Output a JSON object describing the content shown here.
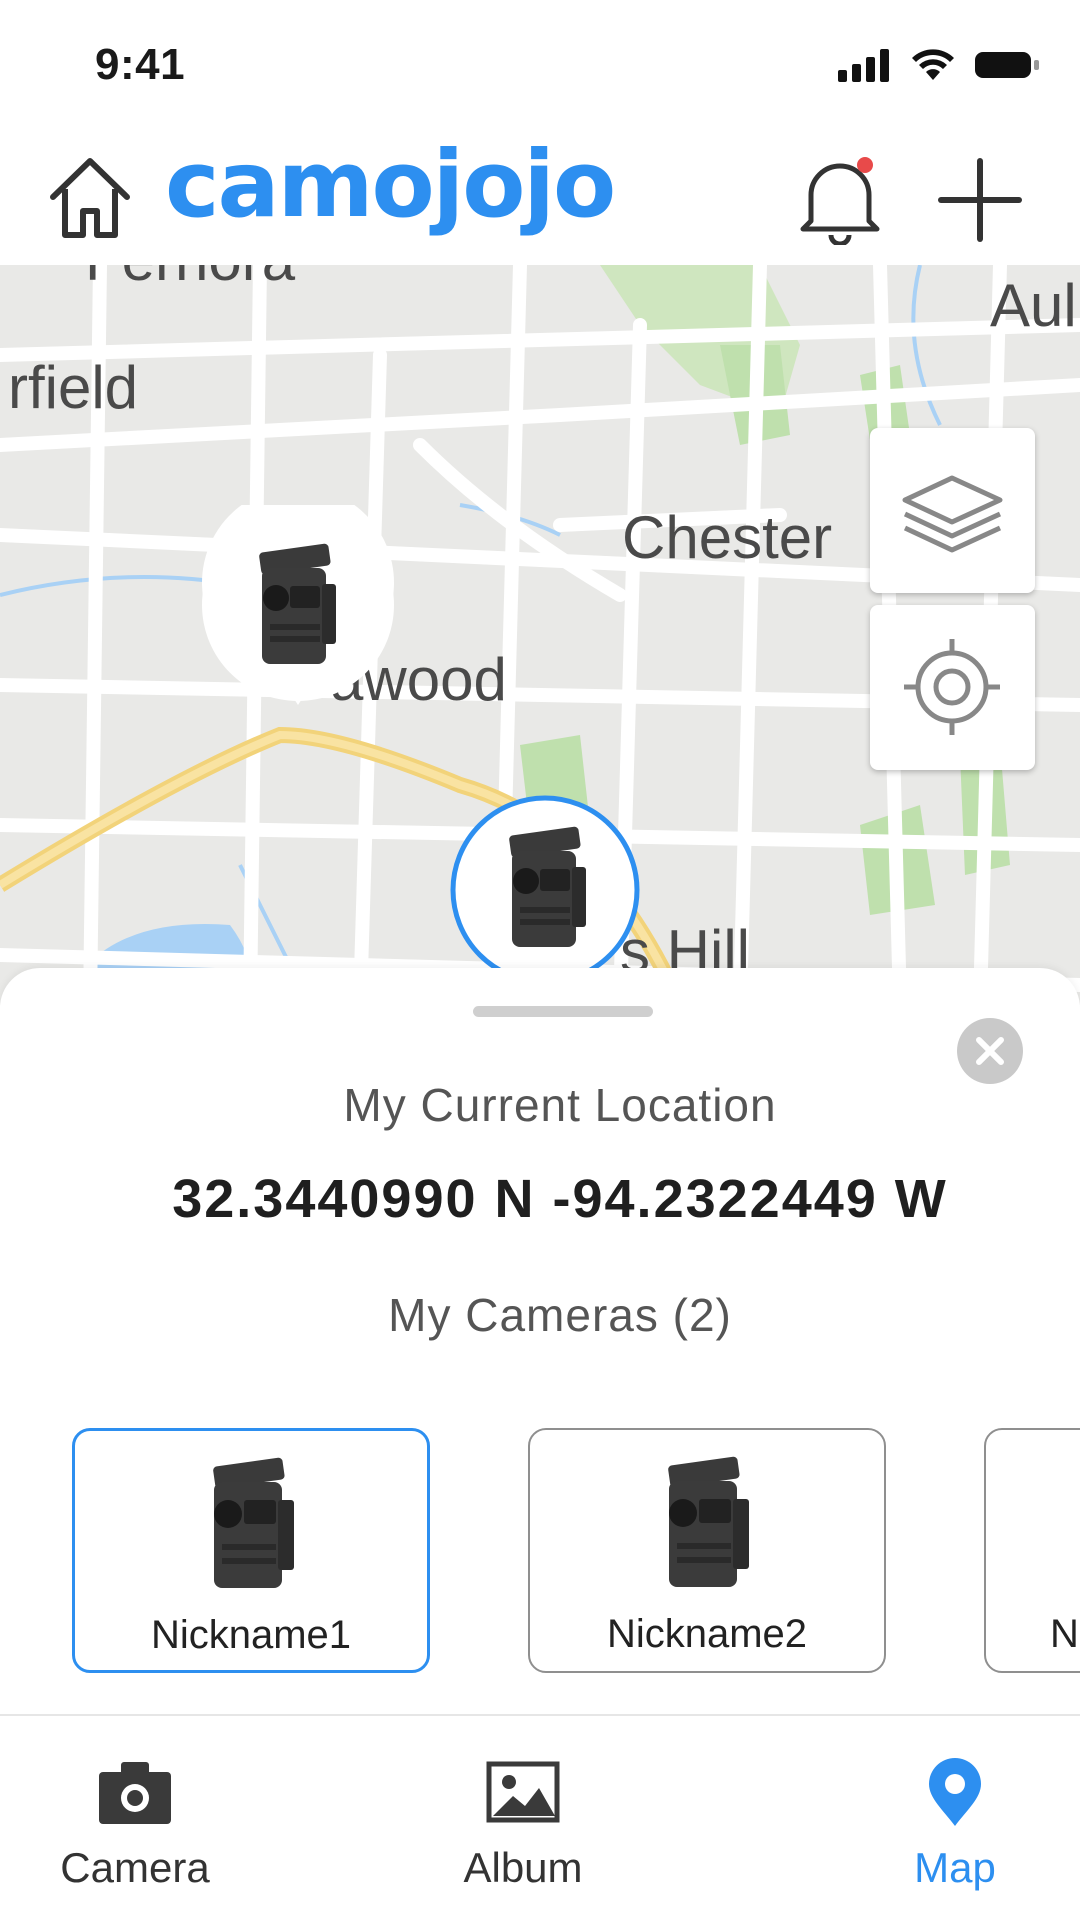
{
  "status_bar": {
    "time": "9:41"
  },
  "header": {
    "logo_text": "camojojo",
    "brand_color": "#2d8ff0",
    "has_notification": true,
    "notification_dot_color": "#e84a4a"
  },
  "map": {
    "labels": [
      "rfield",
      "Chester",
      "awood",
      "Aul",
      "s Hill",
      "Fernora"
    ],
    "controls": {
      "layers_icon": "layers-icon",
      "locate_icon": "locate-icon"
    },
    "markers": [
      {
        "icon": "trail-camera-icon",
        "selected": false
      },
      {
        "icon": "trail-camera-icon",
        "selected": true
      }
    ]
  },
  "sheet": {
    "location_title": "My Current Location",
    "coordinates": "32.3440990 N -94.2322449 W",
    "cameras_title": "My Cameras (2)",
    "cameras": [
      {
        "name": "Nickname1",
        "selected": true
      },
      {
        "name": "Nickname2",
        "selected": false
      },
      {
        "name": "N",
        "selected": false
      }
    ]
  },
  "tabs": [
    {
      "label": "Camera",
      "icon": "camera-icon",
      "active": false
    },
    {
      "label": "Album",
      "icon": "album-icon",
      "active": false
    },
    {
      "label": "Map",
      "icon": "map-pin-icon",
      "active": true
    }
  ]
}
